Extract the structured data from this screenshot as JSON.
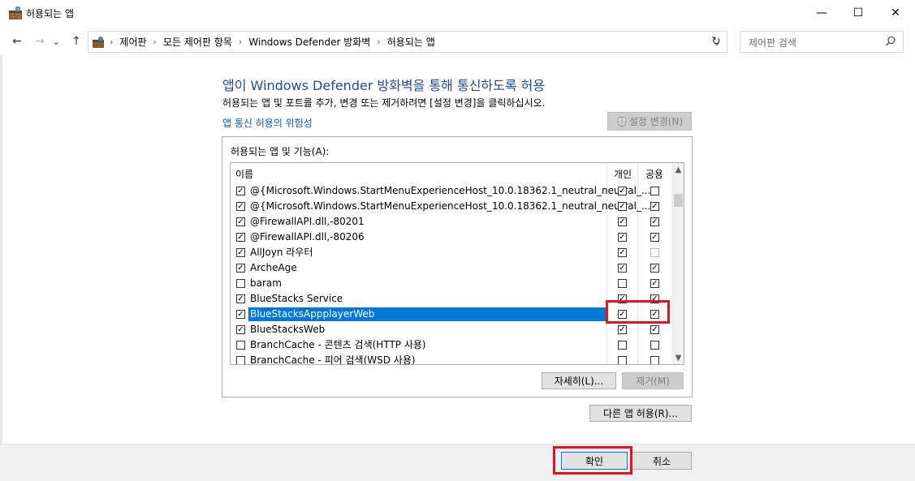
{
  "window": {
    "title": "허용되는 앱",
    "minimize_glyph": "—",
    "maximize_glyph": "☐",
    "close_glyph": "✕"
  },
  "nav": {
    "back_glyph": "←",
    "forward_glyph": "→",
    "recent_glyph": "⌄",
    "up_glyph": "↑",
    "breadcrumbs": [
      "제어판",
      "모든 제어판 항목",
      "Windows Defender 방화벽",
      "허용되는 앱"
    ],
    "refresh_glyph": "↻",
    "dropdown_glyph": "⌄"
  },
  "search": {
    "placeholder": "제어판 검색",
    "icon": "search-icon"
  },
  "main": {
    "heading": "앱이 Windows Defender 방화벽을 통해 통신하도록 허용",
    "subtext": "허용되는 앱 및 포트를 추가, 변경 또는 제거하려면 [설정 변경]을 클릭하십시오.",
    "risk_link": "앱 통신 허용의 위험성",
    "change_settings_button": "설정 변경(N)",
    "group_label": "허용되는 앱 및 기능(A):",
    "columns": {
      "name": "이름",
      "private": "개인",
      "public": "공용"
    },
    "apps": [
      {
        "name": "@{Microsoft.Windows.StartMenuExperienceHost_10.0.18362.1_neutral_neutral_...",
        "enabled": true,
        "private": true,
        "public": false
      },
      {
        "name": "@{Microsoft.Windows.StartMenuExperienceHost_10.0.18362.1_neutral_neutral_...",
        "enabled": true,
        "private": true,
        "public": true
      },
      {
        "name": "@FirewallAPI.dll,-80201",
        "enabled": true,
        "private": true,
        "public": true
      },
      {
        "name": "@FirewallAPI.dll,-80206",
        "enabled": true,
        "private": true,
        "public": true
      },
      {
        "name": "AllJoyn 라우터",
        "enabled": true,
        "private": true,
        "public": false,
        "public_light": true
      },
      {
        "name": "ArcheAge",
        "enabled": true,
        "private": true,
        "public": true
      },
      {
        "name": "baram",
        "enabled": false,
        "private": false,
        "public": true
      },
      {
        "name": "BlueStacks Service",
        "enabled": true,
        "private": true,
        "public": true
      },
      {
        "name": "BlueStacksAppplayerWeb",
        "enabled": true,
        "private": true,
        "public": true,
        "selected": true
      },
      {
        "name": "BlueStacksWeb",
        "enabled": true,
        "private": true,
        "public": true
      },
      {
        "name": "BranchCache - 콘텐츠 검색(HTTP 사용)",
        "enabled": false,
        "private": false,
        "public": false
      },
      {
        "name": "BranchCache - 피어 검색(WSD 사용)",
        "enabled": false,
        "private": false,
        "public": false
      }
    ],
    "details_button": "자세히(L)...",
    "remove_button": "제거(M)",
    "allow_other_app_button": "다른 앱 허용(R)..."
  },
  "footer": {
    "ok_button": "확인",
    "cancel_button": "취소"
  },
  "colors": {
    "accent": "#0078d7",
    "heading": "#1e4b9f",
    "link": "#0b58b5",
    "highlight_box": "#e81123"
  }
}
